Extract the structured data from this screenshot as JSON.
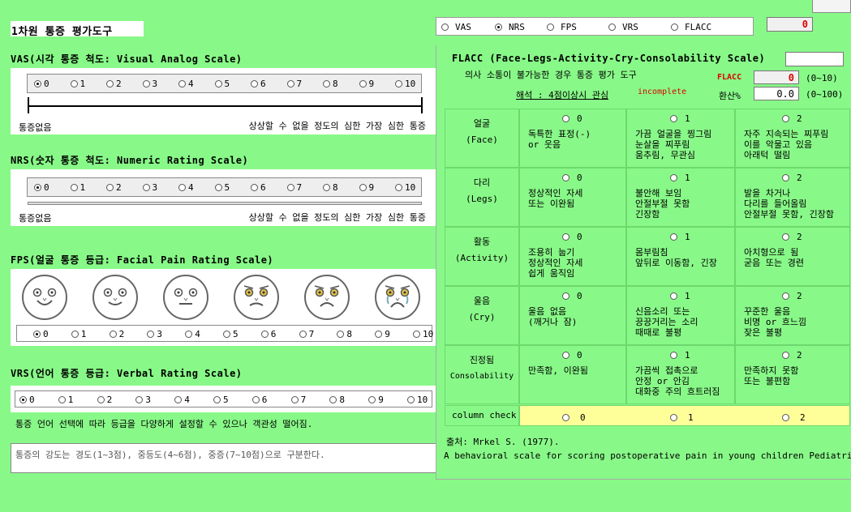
{
  "window": {
    "title": "1차원 통증 평가도구"
  },
  "vas": {
    "title": "VAS(시각 통증 척도: Visual Analog Scale)",
    "options": [
      "0",
      "1",
      "2",
      "3",
      "4",
      "5",
      "6",
      "7",
      "8",
      "9",
      "10"
    ],
    "selected": "0",
    "left_label": "통증없음",
    "right_label": "상상할 수 없을 정도의 심한 가장 심한 통증"
  },
  "nrs": {
    "title": "NRS(숫자 통증 척도: Numeric Rating Scale)",
    "options": [
      "0",
      "1",
      "2",
      "3",
      "4",
      "5",
      "6",
      "7",
      "8",
      "9",
      "10"
    ],
    "selected": "0",
    "left_label": "통증없음",
    "right_label": "상상할 수 없을 정도의 심한 가장 심한 통증"
  },
  "fps": {
    "title": "FPS(얼굴 통증 등급: Facial Pain Rating Scale)",
    "options": [
      "0",
      "1",
      "2",
      "3",
      "4",
      "5",
      "6",
      "7",
      "8",
      "9",
      "10"
    ],
    "selected": "0"
  },
  "vrs": {
    "title": "VRS(언어 통증 등급: Verbal Rating Scale)",
    "options": [
      "0",
      "1",
      "2",
      "3",
      "4",
      "5",
      "6",
      "7",
      "8",
      "9",
      "10"
    ],
    "selected": "0",
    "note": "통증 언어 선택에 따라 등급을 다양하게 설정할 수 있으나 객관성 떨어짐.",
    "textarea": "통증의 강도는 경도(1~3점), 중등도(4~6점), 중증(7~10점)으로 구분한다."
  },
  "scale_selector": {
    "options": [
      "VAS",
      "NRS",
      "FPS",
      "VRS",
      "FLACC"
    ],
    "selected": "NRS",
    "score": "0"
  },
  "flacc": {
    "title": "FLACC (Face-Legs-Activity-Cry-Consolability Scale)",
    "subtitle": "의사 소통이 불가능한 경우 통증 평가 도구",
    "interpretation": "해석 : 4점이상시 관심",
    "status": "incomplete",
    "score_label": "FLACC",
    "score": "0",
    "score_range": "(0~10)",
    "percent_label": "환산%",
    "percent": "0.0",
    "percent_range": "(0~100)",
    "title_input": "",
    "rows": [
      {
        "name": "얼굴",
        "eng": "(Face)",
        "cells": [
          "독특한 표정(-)\nor 웃음",
          "가끔 얼굴을 찡그림\n눈살을 찌푸림\n움추림, 무관심",
          "자주 지속되는 찌푸림\n이를 악물고 있음\n아래턱 떨림"
        ]
      },
      {
        "name": "다리",
        "eng": "(Legs)",
        "cells": [
          "정상적인 자세\n또는 이완됨",
          "불안해 보임\n안절부절 못함\n긴장함",
          "발을 차거나\n다리를 들어올림\n안절부절 못함, 긴장함"
        ]
      },
      {
        "name": "활동",
        "eng": "(Activity)",
        "cells": [
          "조용히 눕기\n정상적인 자세\n쉽게 움직임",
          "몸부림침\n앞뒤로 이동함, 긴장",
          "아치형으로 됨\n굳음 또는 경련"
        ]
      },
      {
        "name": "울음",
        "eng": "(Cry)",
        "cells": [
          "울음 없음\n(깨거나 잠)",
          "신음소리 또는\n끙끙거리는 소리\n때때로 불평",
          "꾸준한 울음\n비명 or 흐느낌\n잦은 불평"
        ]
      },
      {
        "name": "진정됨",
        "eng": "Consolability",
        "cells": [
          "만족함, 이완됨",
          "가끔씩 접촉으로\n안정 or 안김\n대화중 주의 흐트러짐",
          "만족하지 못함\n또는 불편함"
        ]
      }
    ],
    "scores": [
      "0",
      "1",
      "2"
    ],
    "column_check_label": "column check",
    "source": "출처: Mrkel S. (1977).",
    "reference": "A behavioral scale for scoring postoperative pain in young children Pediatric Nursing"
  }
}
